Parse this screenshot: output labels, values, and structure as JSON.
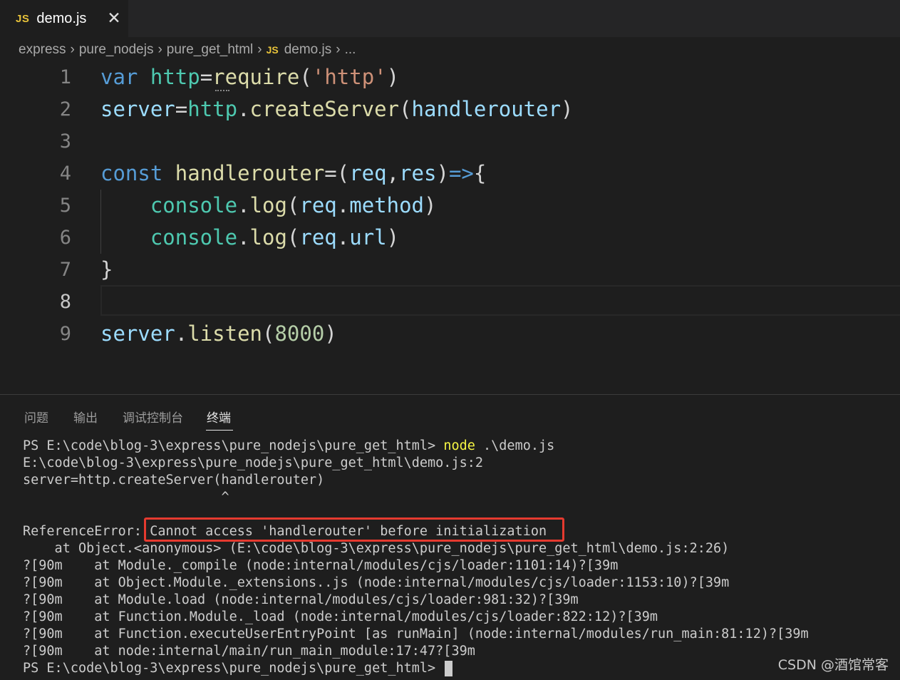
{
  "tab": {
    "badge": "JS",
    "label": "demo.js",
    "close": "✕"
  },
  "breadcrumb": {
    "items": [
      "express",
      "pure_nodejs",
      "pure_get_html"
    ],
    "file_badge": "JS",
    "file": "demo.js",
    "more": "...",
    "separator": "›"
  },
  "editor": {
    "line_numbers": [
      "1",
      "2",
      "3",
      "4",
      "5",
      "6",
      "7",
      "8",
      "9"
    ],
    "active_line": "8",
    "lines": [
      [
        [
          "kw",
          "var"
        ],
        [
          "plain",
          " "
        ],
        [
          "var",
          "http"
        ],
        [
          "plain",
          "="
        ],
        [
          "fn",
          "require"
        ],
        [
          "plain",
          "("
        ],
        [
          "str",
          "'http'"
        ],
        [
          "plain",
          ")"
        ]
      ],
      [
        [
          "obj",
          "server"
        ],
        [
          "plain",
          "="
        ],
        [
          "var",
          "http"
        ],
        [
          "plain",
          "."
        ],
        [
          "fn",
          "createServer"
        ],
        [
          "plain",
          "("
        ],
        [
          "prm",
          "handlerouter"
        ],
        [
          "plain",
          ")"
        ]
      ],
      [],
      [
        [
          "kw",
          "const"
        ],
        [
          "plain",
          " "
        ],
        [
          "fn",
          "handlerouter"
        ],
        [
          "plain",
          "=("
        ],
        [
          "prm",
          "req"
        ],
        [
          "plain",
          ","
        ],
        [
          "prm",
          "res"
        ],
        [
          "plain",
          ")"
        ],
        [
          "kw",
          "=>"
        ],
        [
          "plain",
          "{"
        ]
      ],
      [
        [
          "plain",
          "    "
        ],
        [
          "var",
          "console"
        ],
        [
          "plain",
          "."
        ],
        [
          "fn",
          "log"
        ],
        [
          "plain",
          "("
        ],
        [
          "prm",
          "req"
        ],
        [
          "plain",
          "."
        ],
        [
          "prm",
          "method"
        ],
        [
          "plain",
          ")"
        ]
      ],
      [
        [
          "plain",
          "    "
        ],
        [
          "var",
          "console"
        ],
        [
          "plain",
          "."
        ],
        [
          "fn",
          "log"
        ],
        [
          "plain",
          "("
        ],
        [
          "prm",
          "req"
        ],
        [
          "plain",
          "."
        ],
        [
          "prm",
          "url"
        ],
        [
          "plain",
          ")"
        ]
      ],
      [
        [
          "plain",
          "}"
        ]
      ],
      [],
      [
        [
          "obj",
          "server"
        ],
        [
          "plain",
          "."
        ],
        [
          "fn",
          "listen"
        ],
        [
          "plain",
          "("
        ],
        [
          "num",
          "8000"
        ],
        [
          "plain",
          ")"
        ]
      ]
    ]
  },
  "panel": {
    "tabs": [
      "问题",
      "输出",
      "调试控制台",
      "终端"
    ],
    "active_tab": "终端"
  },
  "terminal": {
    "prompt_line": {
      "prompt": "PS E:\\code\\blog-3\\express\\pure_nodejs\\pure_get_html> ",
      "command": "node",
      "args": " .\\demo.js"
    },
    "lines": [
      "E:\\code\\blog-3\\express\\pure_nodejs\\pure_get_html\\demo.js:2",
      "server=http.createServer(handlerouter)",
      "                         ^",
      "",
      "ReferenceError: Cannot access 'handlerouter' before initialization",
      "    at Object.<anonymous> (E:\\code\\blog-3\\express\\pure_nodejs\\pure_get_html\\demo.js:2:26)",
      "?[90m    at Module._compile (node:internal/modules/cjs/loader:1101:14)?[39m",
      "?[90m    at Object.Module._extensions..js (node:internal/modules/cjs/loader:1153:10)?[39m",
      "?[90m    at Module.load (node:internal/modules/cjs/loader:981:32)?[39m",
      "?[90m    at Function.Module._load (node:internal/modules/cjs/loader:822:12)?[39m",
      "?[90m    at Function.executeUserEntryPoint [as runMain] (node:internal/modules/run_main:81:12)?[39m",
      "?[90m    at node:internal/main/run_main_module:17:47?[39m"
    ],
    "final_prompt": "PS E:\\code\\blog-3\\express\\pure_nodejs\\pure_get_html> "
  },
  "watermark": "CSDN @酒馆常客"
}
